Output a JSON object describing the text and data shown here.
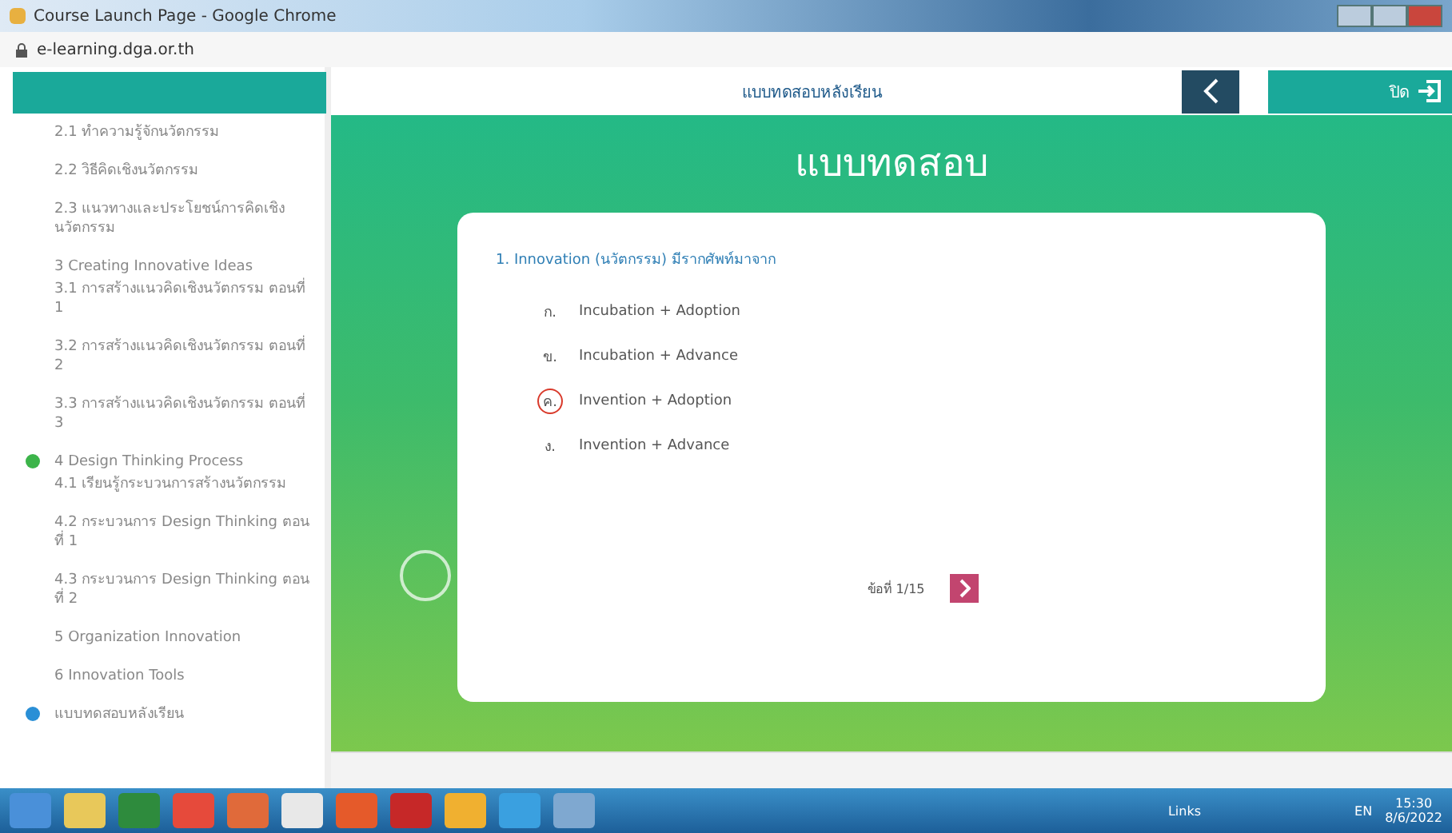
{
  "window": {
    "title": "Course Launch Page - Google Chrome",
    "url": "e-learning.dga.or.th"
  },
  "header": {
    "title": "แบบทดสอบหลังเรียน",
    "close_label": "ปิด"
  },
  "sidebar": {
    "items": [
      {
        "lines": [
          "2.1 ทำความรู้จักนวัตกรรม"
        ]
      },
      {
        "lines": [
          "2.2 วิธีคิดเชิงนวัตกรรม"
        ]
      },
      {
        "lines": [
          "2.3 แนวทางและประโยชน์การคิดเชิงนวัตกรรม"
        ]
      },
      {
        "lines": [
          "3 Creating Innovative Ideas",
          "3.1 การสร้างแนวคิดเชิงนวัตกรรม ตอนที่ 1"
        ]
      },
      {
        "lines": [
          "3.2 การสร้างแนวคิดเชิงนวัตกรรม ตอนที่ 2"
        ]
      },
      {
        "lines": [
          "3.3 การสร้างแนวคิดเชิงนวัตกรรม ตอนที่ 3"
        ]
      },
      {
        "lines": [
          "4 Design Thinking Process",
          "4.1 เรียนรู้กระบวนการสร้างนวัตกรรม"
        ],
        "color": "#3cb44a"
      },
      {
        "lines": [
          "4.2 กระบวนการ Design Thinking ตอนที่ 1"
        ]
      },
      {
        "lines": [
          "4.3 กระบวนการ Design Thinking ตอนที่ 2"
        ]
      },
      {
        "lines": [
          "5 Organization Innovation"
        ]
      },
      {
        "lines": [
          "6 Innovation Tools"
        ]
      },
      {
        "lines": [
          "แบบทดสอบหลังเรียน"
        ],
        "color": "#2a8fd6"
      }
    ]
  },
  "quiz": {
    "title": "แบบทดสอบ",
    "question": "1. Innovation (นวัตกรรม) มีรากศัพท์มาจาก",
    "options": [
      {
        "letter": "ก.",
        "text": "Incubation + Adoption",
        "selected": false
      },
      {
        "letter": "ข.",
        "text": "Incubation + Advance",
        "selected": false
      },
      {
        "letter": "ค.",
        "text": "Invention + Adoption",
        "selected": true
      },
      {
        "letter": "ง.",
        "text": "Invention + Advance",
        "selected": false
      }
    ],
    "progress": "ข้อที่ 1/15"
  },
  "taskbar": {
    "links": "Links",
    "language": "EN",
    "time": "15:30",
    "date": "8/6/2022"
  }
}
